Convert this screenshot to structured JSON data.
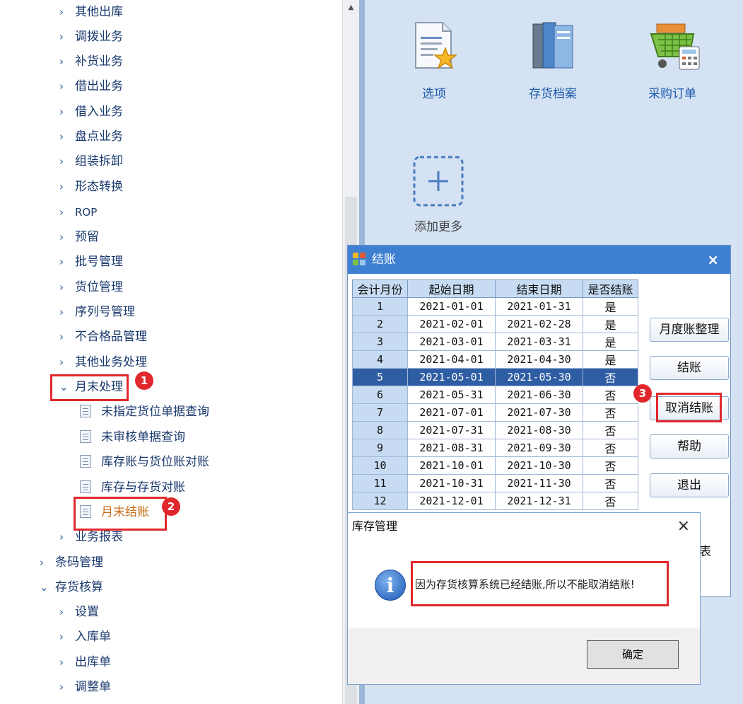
{
  "tree": {
    "items": [
      {
        "label": "其他出库",
        "arrow": "›"
      },
      {
        "label": "调拨业务",
        "arrow": "›"
      },
      {
        "label": "补货业务",
        "arrow": "›"
      },
      {
        "label": "借出业务",
        "arrow": "›"
      },
      {
        "label": "借入业务",
        "arrow": "›"
      },
      {
        "label": "盘点业务",
        "arrow": "›"
      },
      {
        "label": "组装拆卸",
        "arrow": "›"
      },
      {
        "label": "形态转换",
        "arrow": "›"
      },
      {
        "label": "ROP",
        "arrow": "›"
      },
      {
        "label": "预留",
        "arrow": "›"
      },
      {
        "label": "批号管理",
        "arrow": "›"
      },
      {
        "label": "货位管理",
        "arrow": "›"
      },
      {
        "label": "序列号管理",
        "arrow": "›"
      },
      {
        "label": "不合格品管理",
        "arrow": "›"
      },
      {
        "label": "其他业务处理",
        "arrow": "›"
      },
      {
        "label": "月末处理",
        "arrow": "⌄"
      }
    ],
    "month_end_children": [
      {
        "label": "未指定货位单据查询"
      },
      {
        "label": "未审核单据查询"
      },
      {
        "label": "库存账与货位账对账"
      },
      {
        "label": "库存与存货对账"
      },
      {
        "label": "月末结账"
      }
    ],
    "after_items": [
      {
        "label": "业务报表",
        "arrow": "›"
      }
    ],
    "top_items": [
      {
        "label": "条码管理",
        "arrow": "›"
      },
      {
        "label": "存货核算",
        "arrow": "⌄"
      }
    ],
    "inventory_children": [
      {
        "label": "设置",
        "arrow": "›"
      },
      {
        "label": "入库单",
        "arrow": "›"
      },
      {
        "label": "出库单",
        "arrow": "›"
      },
      {
        "label": "调整单",
        "arrow": "›"
      }
    ]
  },
  "tiles": {
    "options": "选项",
    "inventory_file": "存货档案",
    "purchase_order": "采购订单",
    "add_more": "添加更多"
  },
  "closing_dialog": {
    "title": "结账",
    "close": "×",
    "columns": [
      "会计月份",
      "起始日期",
      "结束日期",
      "是否结账"
    ],
    "rows": [
      [
        "1",
        "2021-01-01",
        "2021-01-31",
        "是"
      ],
      [
        "2",
        "2021-02-01",
        "2021-02-28",
        "是"
      ],
      [
        "3",
        "2021-03-01",
        "2021-03-31",
        "是"
      ],
      [
        "4",
        "2021-04-01",
        "2021-04-30",
        "是"
      ],
      [
        "5",
        "2021-05-01",
        "2021-05-30",
        "否"
      ],
      [
        "6",
        "2021-05-31",
        "2021-06-30",
        "否"
      ],
      [
        "7",
        "2021-07-01",
        "2021-07-30",
        "否"
      ],
      [
        "8",
        "2021-07-31",
        "2021-08-30",
        "否"
      ],
      [
        "9",
        "2021-08-31",
        "2021-09-30",
        "否"
      ],
      [
        "10",
        "2021-10-01",
        "2021-10-30",
        "否"
      ],
      [
        "11",
        "2021-10-31",
        "2021-11-30",
        "否"
      ],
      [
        "12",
        "2021-12-01",
        "2021-12-31",
        "否"
      ]
    ],
    "selected_row": 4,
    "buttons": {
      "monthly_tidy": "月度账整理",
      "close_account": "结账",
      "cancel_close": "取消结账",
      "help": "帮助",
      "exit": "退出"
    },
    "partial_hidden_text": "表"
  },
  "message_box": {
    "title": "库存管理",
    "close": "×",
    "icon": "i",
    "text": "因为存货核算系统已经结账,所以不能取消结账!",
    "ok": "确定"
  },
  "badges": {
    "b1": "1",
    "b2": "2",
    "b3": "3"
  },
  "colors": {
    "annotation_red": "#e0282c",
    "title_blue": "#3d7fd0",
    "selected_row": "#2e5da3"
  }
}
